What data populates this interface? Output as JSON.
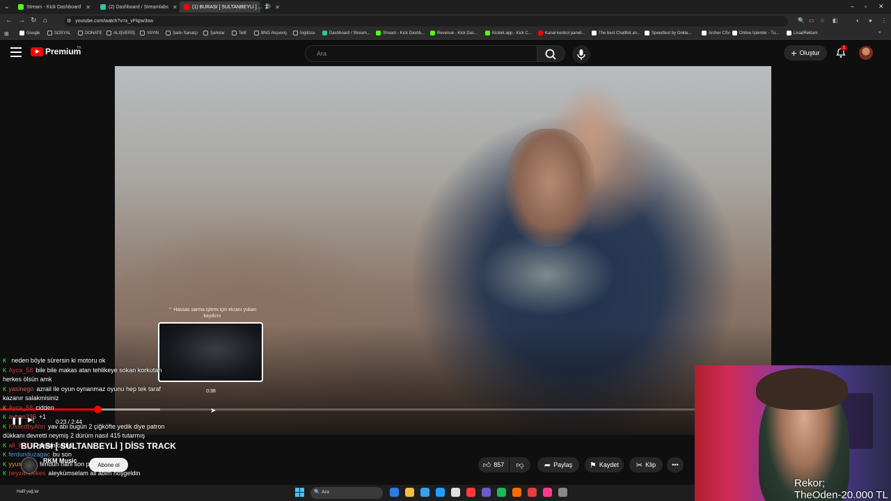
{
  "browser": {
    "tabs": [
      {
        "label": "Stream - Kick Dashboard",
        "favicon_color": "#53fc18",
        "active": false
      },
      {
        "label": "(2) Dashboard / Streamlabs",
        "favicon_color": "#31c3a2",
        "active": false
      },
      {
        "label": "(1) BURASI [ SULTANBEYLİ ] ...",
        "favicon_color": "#ff0000",
        "active": true
      }
    ],
    "url": "youtube.com/watch?v=x_vFkpw3sw",
    "bookmarks": [
      {
        "label": "Google",
        "color": "#ffffff"
      },
      {
        "label": "SOSYAL",
        "color": "#bdbdbd"
      },
      {
        "label": "DONATE",
        "color": "#bdbdbd"
      },
      {
        "label": "ALIŞVERİŞ",
        "color": "#bdbdbd"
      },
      {
        "label": "YAYIN",
        "color": "#bdbdbd"
      },
      {
        "label": "Şarkı Sanatçı",
        "color": "#bdbdbd"
      },
      {
        "label": "Şarkılar",
        "color": "#bdbdbd"
      },
      {
        "label": "Telif",
        "color": "#bdbdbd"
      },
      {
        "label": "BNG Alışveriş",
        "color": "#bdbdbd"
      },
      {
        "label": "İngilizce",
        "color": "#bdbdbd"
      },
      {
        "label": "Dashboard / Stream...",
        "color": "#31c3a2"
      },
      {
        "label": "Stream - Kick Dashb...",
        "color": "#53fc18"
      },
      {
        "label": "Revenue - Kick Das...",
        "color": "#53fc18"
      },
      {
        "label": "Kicklet.app - Kick C...",
        "color": "#53fc18"
      },
      {
        "label": "Kanal kontrol paneli...",
        "color": "#ff0000"
      },
      {
        "label": "The best ChatBot an...",
        "color": "#ffffff"
      },
      {
        "label": "Speedtest by Ookla...",
        "color": "#ffffff"
      },
      {
        "label": "Archer CSv",
        "color": "#ffffff"
      },
      {
        "label": "Online İşlemler - Tu...",
        "color": "#ffffff"
      },
      {
        "label": "LivadReklam",
        "color": "#ffffff"
      }
    ]
  },
  "youtube": {
    "logo_text": "Premium",
    "logo_region": "TR",
    "search_placeholder": "Ara",
    "create_label": "Oluştur",
    "notification_count": "1",
    "brand_color": "#ff0000"
  },
  "player": {
    "scrub_hint": "Hassas sarma işlemi için ekranı yukarı kaydırın",
    "scrub_time": "0:38",
    "time_display": "0:23 / 2:44",
    "progress_fraction": 0.14,
    "buffer_fraction": 0.23
  },
  "video": {
    "title": "BURASI [ SULTANBEYLİ ] DİSS TRACK",
    "channel_name": "RKM Music",
    "subscribe_label": "Abone ol",
    "likes": "857",
    "share_label": "Paylaş",
    "save_label": "Kaydet",
    "clip_label": "Klip"
  },
  "chat": {
    "kick_color": "#53fc18",
    "messages": [
      {
        "user": "",
        "color": "#d04040",
        "text": "neden böyle sürersin ki motoru ok"
      },
      {
        "user": "Ayca_58",
        "color": "#d04040",
        "text": "bile bile makas atan tehlikeye sokan korkutan herkes ölsün amk"
      },
      {
        "user": "yasinego",
        "color": "#e06060",
        "text": "azrail ile oyun oynanmaz oyunu hep tek taraf kazanır salakmisiniz"
      },
      {
        "user": "Ayca_58",
        "color": "#d04040",
        "text": "cidden"
      },
      {
        "user": "ayhan335",
        "color": "#e06060",
        "text": "+1"
      },
      {
        "user": "KissedbyAhri",
        "color": "#d04040",
        "text": "yav abi bugün 2 çiğköfte yedik diye patron dükkanı devretti neymiş 2 dürüm nasıl 415 tutarmış"
      },
      {
        "user": "ali_88_34",
        "color": "#d04040",
        "text": "selam canlar"
      },
      {
        "user": "ferdunduzagac",
        "color": "#5a9ae6",
        "text": "bu son"
      },
      {
        "user": "yyusufff58",
        "color": "#e0a030",
        "text": "feridun hani son parandı aq"
      },
      {
        "user": "beyzanbekes",
        "color": "#d04040",
        "text": "aleykümselam ali abim hoşgeldin"
      }
    ]
  },
  "overlay": {
    "record_line1": "Rekor;",
    "record_line2": "TheOden-20.000 TL"
  },
  "taskbar": {
    "search_placeholder": "Ara",
    "weather_text": "Hafif yağ.lar",
    "app_colors": [
      "#2a7de1",
      "#f0c040",
      "#3aa0e8",
      "#1ea0ff",
      "#e0e0e0",
      "#ff3b3b",
      "#6a5acd",
      "#1db954",
      "#ff6a00",
      "#e04040",
      "#ff3a8a",
      "#888888"
    ]
  }
}
